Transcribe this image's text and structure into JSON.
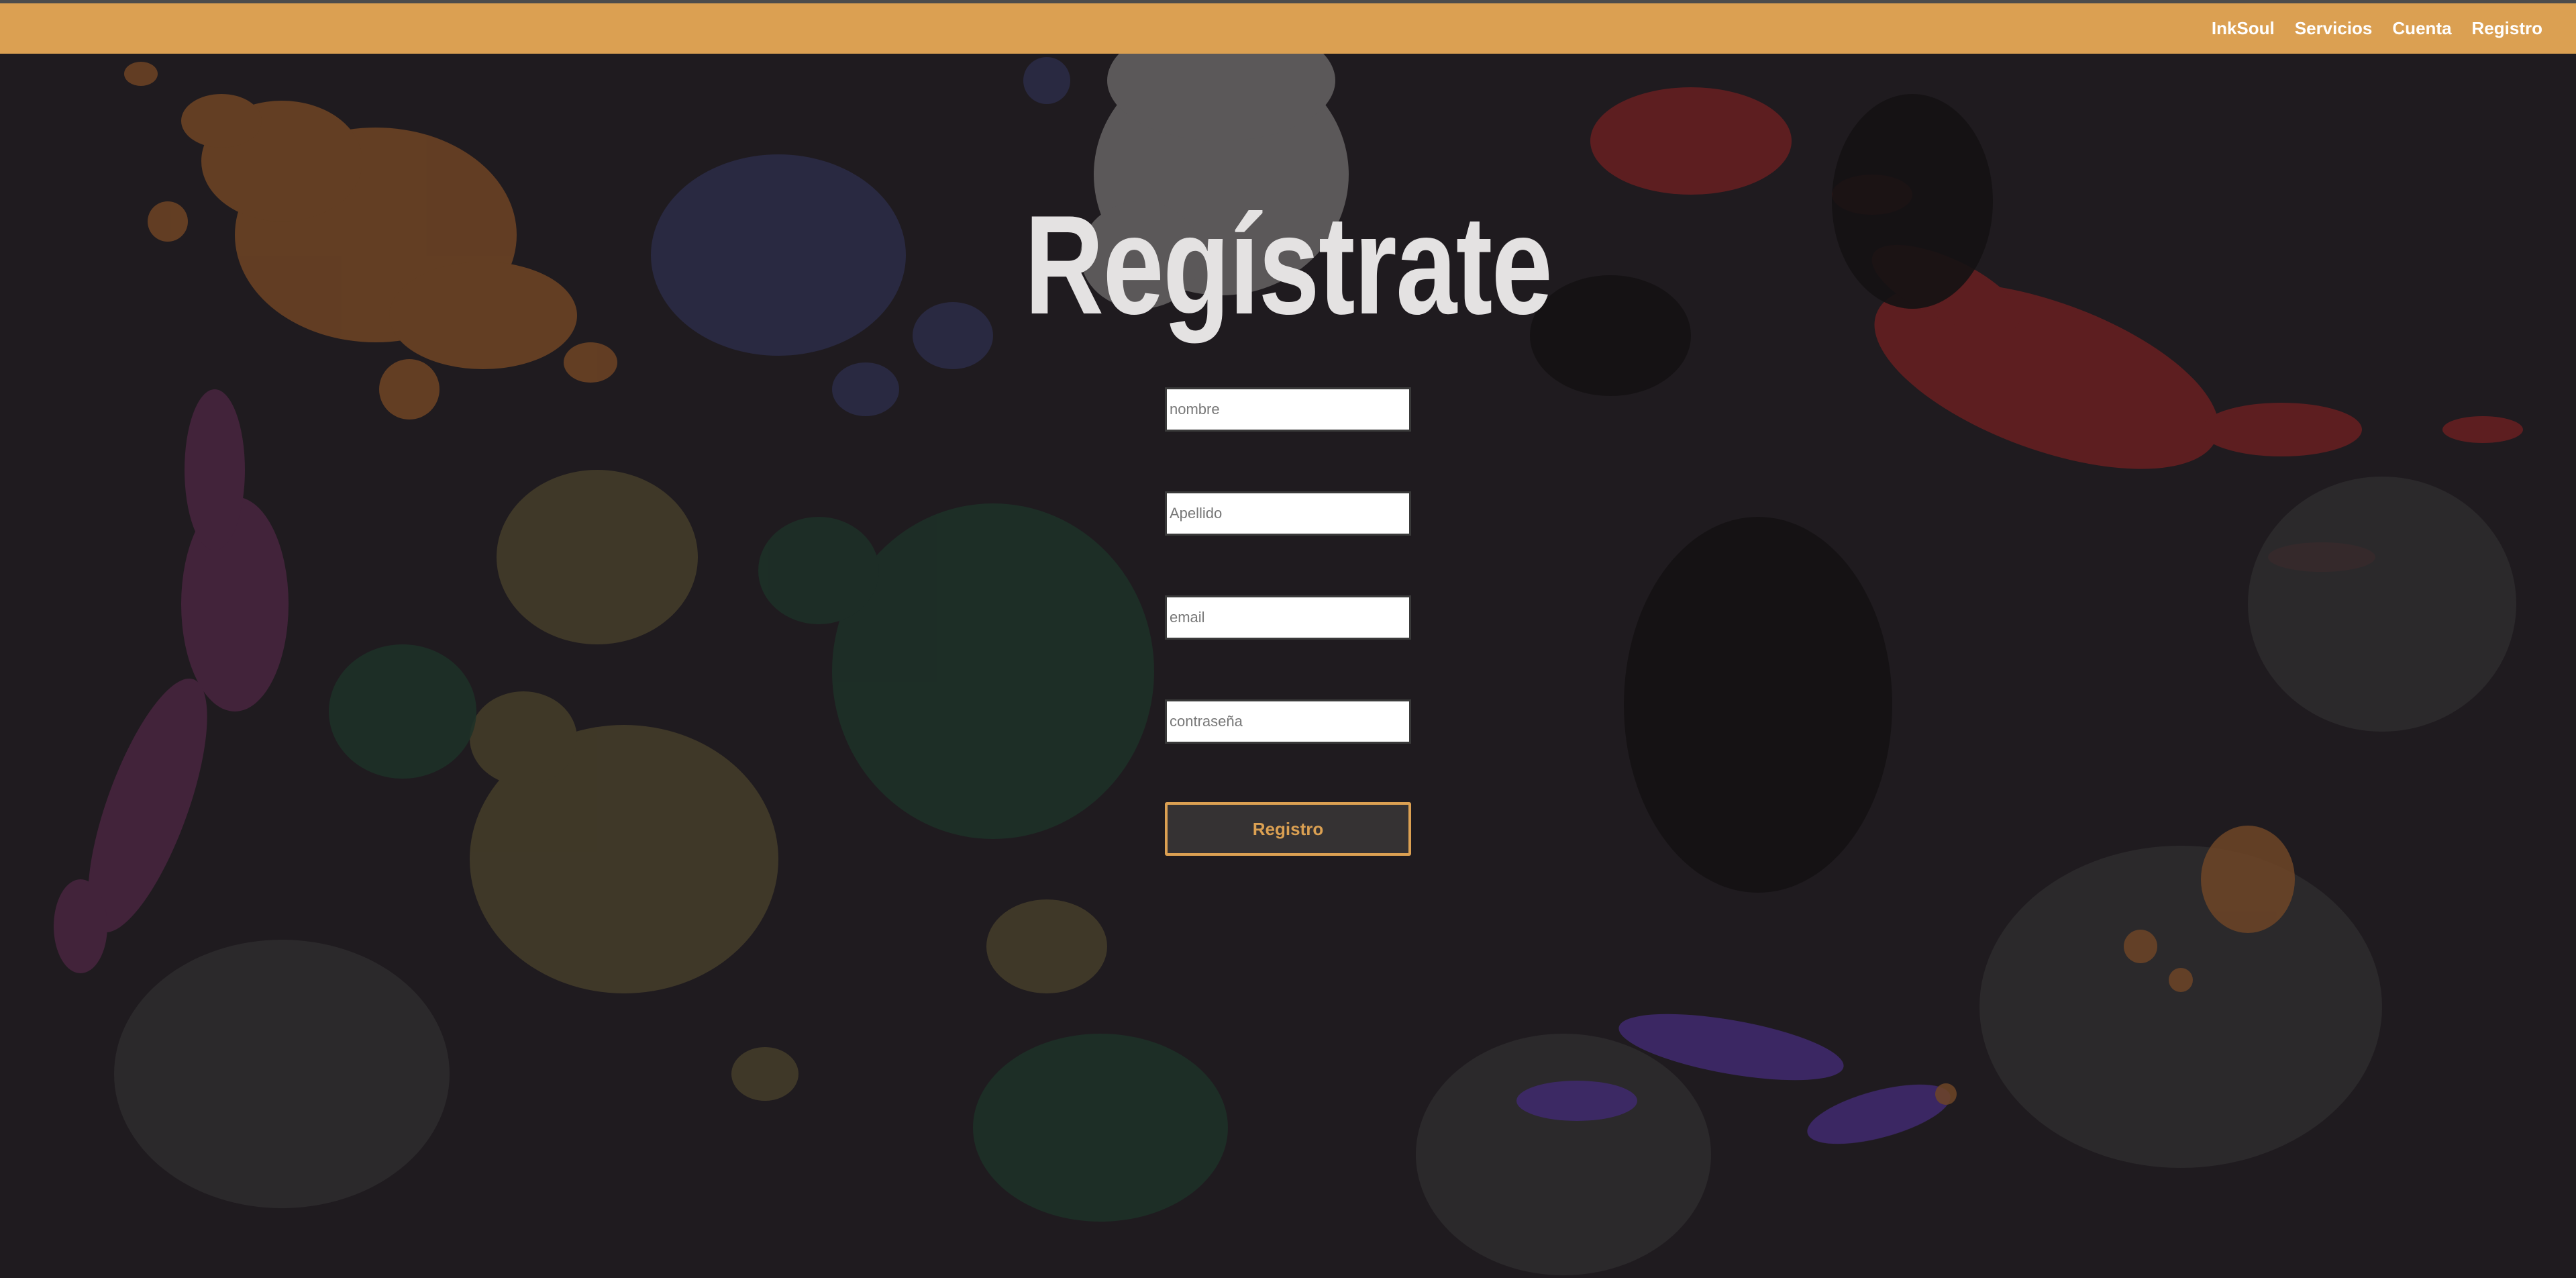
{
  "nav": {
    "items": [
      {
        "label": "InkSoul"
      },
      {
        "label": "Servicios"
      },
      {
        "label": "Cuenta"
      },
      {
        "label": "Registro"
      }
    ]
  },
  "page_title": "Regístrate",
  "form": {
    "nombre_placeholder": "nombre",
    "apellido_placeholder": "Apellido",
    "email_placeholder": "email",
    "password_placeholder": "contraseña",
    "submit_label": "Registro"
  },
  "colors": {
    "accent": "#dba052",
    "background": "#1f1b1f",
    "title": "#e4e2e2"
  }
}
